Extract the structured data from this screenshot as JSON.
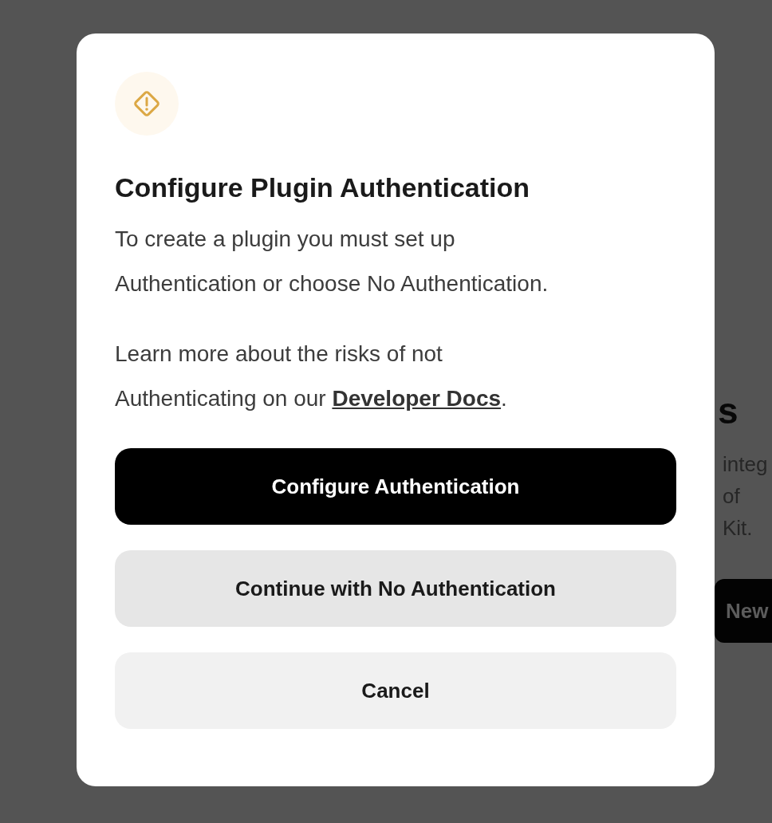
{
  "background": {
    "heading": "s",
    "lines": [
      "integ",
      "of Kit."
    ],
    "button": "New"
  },
  "dialog": {
    "title": "Configure Plugin Authentication",
    "message": "To create a plugin you must set up Authentication or choose No Authentication.",
    "learn_more": {
      "before": "Learn more about the risks of not Authenticating on our ",
      "link": "Developer Docs",
      "after": "."
    },
    "buttons": [
      {
        "label": "Configure Authentication",
        "kind": "primary"
      },
      {
        "label": "Continue with No Authentication",
        "kind": "secondary"
      },
      {
        "label": "Cancel",
        "kind": "tertiary"
      }
    ]
  }
}
